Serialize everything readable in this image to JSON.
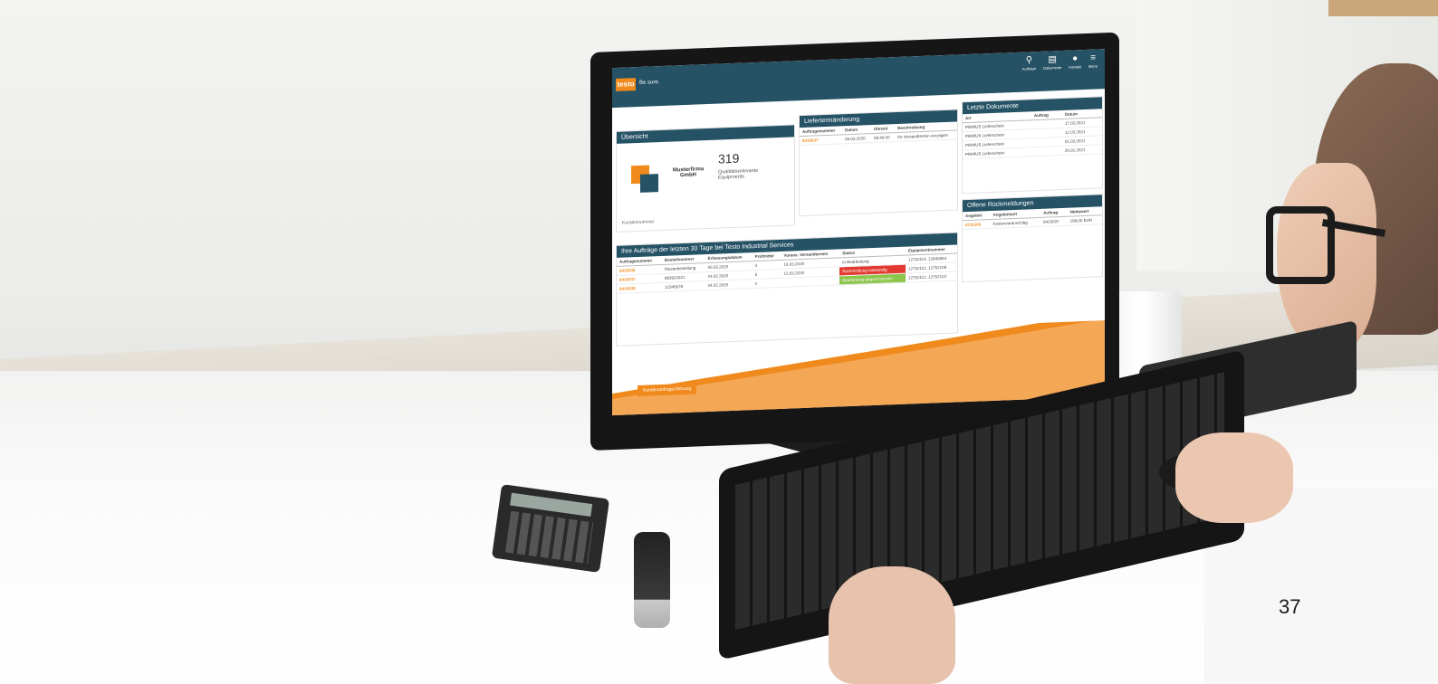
{
  "screen": {
    "brand": "testo",
    "tagline": "Be sure.",
    "nav": [
      {
        "icon": "map-pin-icon",
        "label": "Aufträge"
      },
      {
        "icon": "documents-icon",
        "label": "Dokumente"
      },
      {
        "icon": "user-icon",
        "label": "Kontakt"
      },
      {
        "icon": "menu-icon",
        "label": "Menü"
      }
    ],
    "overview": {
      "title": "Übersicht",
      "company": "Musterfirma GmbH",
      "count": "319",
      "count_label": "Qualitätsrelevante Equipments",
      "customer_no_label": "Kundennummer"
    },
    "delivery": {
      "title": "Liefertermänderung",
      "columns": [
        "Auftragsnummer",
        "Datum",
        "Uhrzeit",
        "Beschreibung"
      ],
      "rows": [
        [
          "8415037",
          "05.03.2020",
          "08:40:00",
          "Ihr Versandtermin verzögert"
        ]
      ]
    },
    "documents": {
      "title": "Letzte Dokumente",
      "columns": [
        "Art",
        "Auftrag",
        "Datum"
      ],
      "rows": [
        [
          "PRIMUS Lieferschein",
          "",
          "17.03.2021"
        ],
        [
          "PRIMUS Lieferschein",
          "",
          "12.03.2021"
        ],
        [
          "PRIMUS Lieferschein",
          "",
          "01.03.2021"
        ],
        [
          "PRIMUS Lieferschein",
          "",
          "26.02.2021"
        ]
      ]
    },
    "feedback": {
      "title": "Offene Rückmeldungen",
      "columns": [
        "Angebot",
        "Angebotsart",
        "Auftrag",
        "Nettowert"
      ],
      "rows": [
        [
          "8711260",
          "Kostenvoranschlag",
          "8415037",
          "198,00 EUR"
        ]
      ]
    },
    "orders": {
      "title": "Ihre Aufträge der letzten 30 Tage bei Testo Industrial Services",
      "columns": [
        "Auftragsnummer",
        "Bestellnummer",
        "Erfassungsdatum",
        "Prüfmittel",
        "Voraus. Versandtermin",
        "Status",
        "Equipmentnummer"
      ],
      "rows": [
        [
          "8415035",
          "Musterbestellung",
          "05.03.2020",
          "4",
          "19.03.2020",
          "In Bearbeitung",
          "12752114, 12845854"
        ],
        [
          "8415037",
          "893924321",
          "24.02.2020",
          "5",
          "12.03.2020",
          "Rückmeldung notwendig",
          "12752112, 12752109"
        ],
        [
          "8415039",
          "12345678",
          "24.02.2020",
          "2",
          "",
          "Bearbeitung abgeschlossen",
          "12752112, 12752122"
        ]
      ]
    },
    "ticket_button": "Kundenanfrage/Störung"
  },
  "page_number": "37",
  "colors": {
    "brand_dark": "#255265",
    "brand_orange": "#f08a1c",
    "status_red": "#e23a30",
    "status_green": "#8bc54a"
  }
}
